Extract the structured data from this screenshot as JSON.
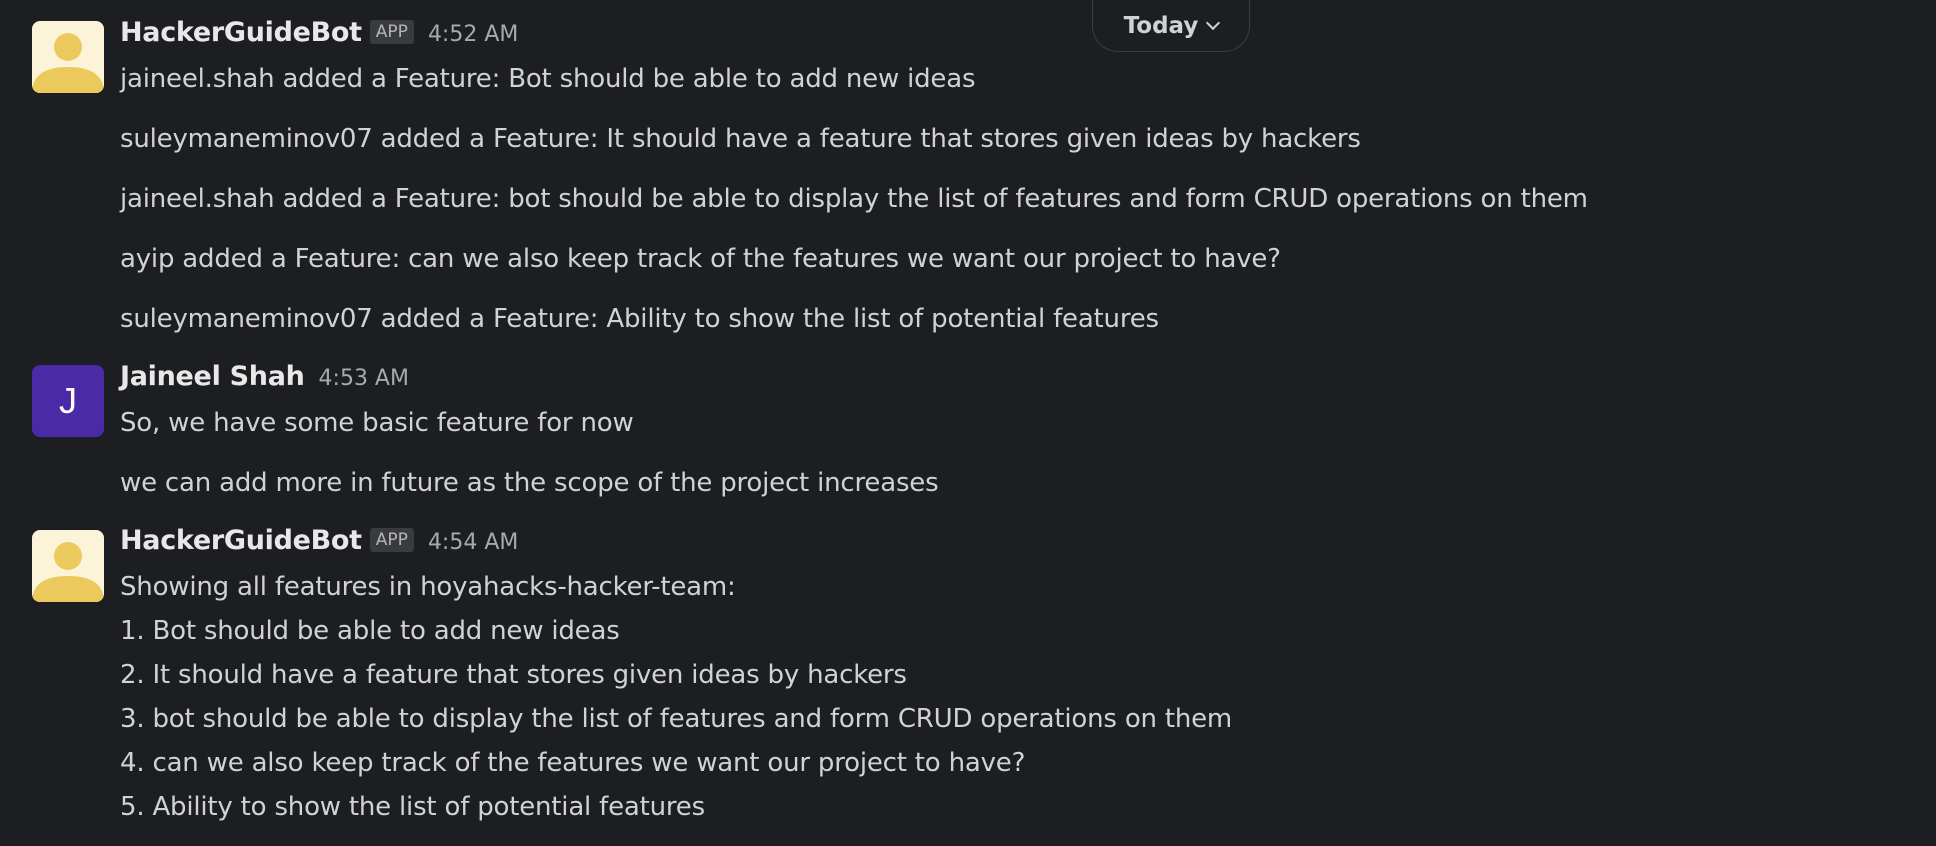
{
  "date_divider": {
    "label": "Today"
  },
  "messages": [
    {
      "author": "HackerGuideBot",
      "badge": "APP",
      "time": "4:52 AM",
      "lines": [
        "jaineel.shah added a Feature: Bot should be able to add new ideas",
        "suleymaneminov07 added a Feature: It should have a feature that stores given ideas by hackers",
        "jaineel.shah added a Feature: bot should be able to display the list of features and form CRUD operations on them",
        "ayip added a Feature: can we also keep track of the features we want our project to have?",
        "suleymaneminov07 added a Feature: Ability to show the list of potential features"
      ]
    },
    {
      "author": "Jaineel Shah",
      "avatar_letter": "J",
      "time": "4:53 AM",
      "lines": [
        "So, we have some basic feature for now",
        "we can add more in future as the scope of the project increases"
      ]
    },
    {
      "author": "HackerGuideBot",
      "badge": "APP",
      "time": "4:54 AM",
      "lines": [
        "Showing all features in hoyahacks-hacker-team:",
        "1. Bot should be able to add new ideas",
        "2. It should have a feature that stores given ideas by hackers",
        "3. bot should be able to display the list of features and form CRUD operations on them",
        "4. can we also keep track of the features we want our project to have?",
        "5. Ability to show the list of potential features"
      ]
    }
  ],
  "colors": {
    "background": "#1d1e21",
    "text": "#d1d2d3",
    "user_avatar": "#4b2aa8",
    "bot_avatar_bg": "#fcf4d9",
    "bot_avatar_fg": "#ecc95d"
  },
  "icons": {
    "bot_avatar": "default-person-avatar-icon",
    "date_chevron": "chevron-down-icon"
  }
}
